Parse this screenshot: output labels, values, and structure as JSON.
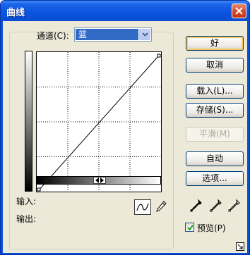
{
  "window": {
    "title": "曲线"
  },
  "channel": {
    "label": "通道(C):",
    "value": "蓝"
  },
  "io": {
    "input_label": "输入:",
    "output_label": "输出:"
  },
  "buttons": {
    "ok": "好",
    "cancel": "取消",
    "load": "载入(L)...",
    "save": "存储(S)...",
    "smooth": "平滑(M)",
    "auto": "自动",
    "options": "选项..."
  },
  "preview": {
    "label": "预览(P)",
    "checked": true
  },
  "icons": {
    "close": "close-icon",
    "curve_tool": "curve-tool-icon",
    "pencil_tool": "pencil-icon",
    "eyedroppers": [
      "black-eyedropper-icon",
      "gray-eyedropper-icon",
      "white-eyedropper-icon"
    ],
    "resize": "expand-icon"
  },
  "curve": {
    "start": [
      0,
      0
    ],
    "end": [
      255,
      255
    ],
    "grid_divisions": 4
  },
  "colors": {
    "title_bar": "#0b55e0",
    "dialog_bg": "#ece9d8",
    "selection": "#316ac5",
    "default_btn_ring": "#f9c95f"
  }
}
